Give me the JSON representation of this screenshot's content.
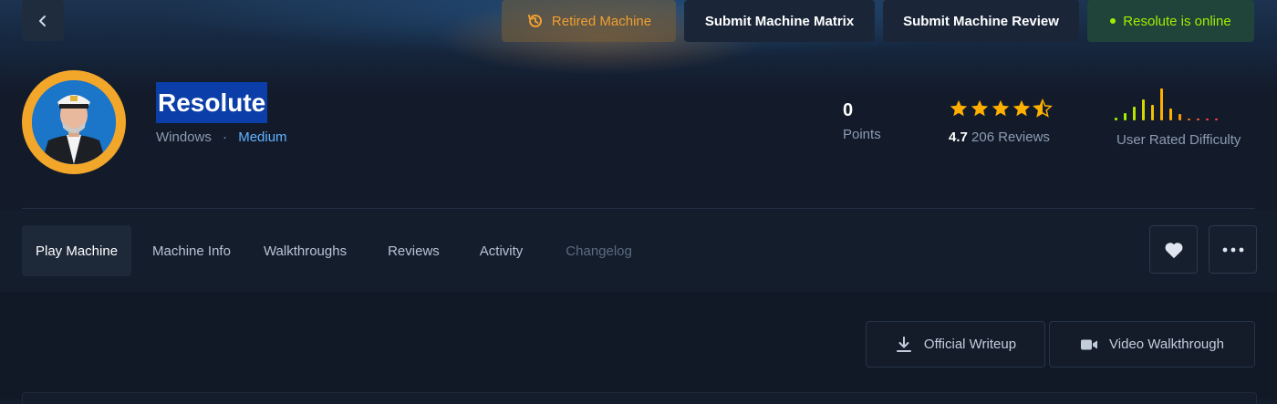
{
  "header": {
    "retired_label": "Retired Machine",
    "matrix_label": "Submit Machine Matrix",
    "review_label": "Submit Machine Review",
    "online_label": "Resolute is online"
  },
  "machine": {
    "name": "Resolute",
    "os": "Windows",
    "separator": "·",
    "difficulty": "Medium"
  },
  "stats": {
    "points_value": "0",
    "points_label": "Points",
    "rating_value": "4.7",
    "rating_count": "206 Reviews",
    "difficulty_label": "User Rated Difficulty",
    "stars_filled": 4.5
  },
  "tabs": [
    {
      "label": "Play Machine"
    },
    {
      "label": "Machine Info"
    },
    {
      "label": "Walkthroughs"
    },
    {
      "label": "Reviews"
    },
    {
      "label": "Activity"
    },
    {
      "label": "Changelog"
    }
  ],
  "writeups": {
    "official_label": "Official Writeup",
    "video_label": "Video Walkthrough"
  },
  "colors": {
    "accent_green": "#9fef00",
    "accent_orange": "#f0a030",
    "star": "#ffaf00",
    "link_blue": "#61b3ff"
  }
}
